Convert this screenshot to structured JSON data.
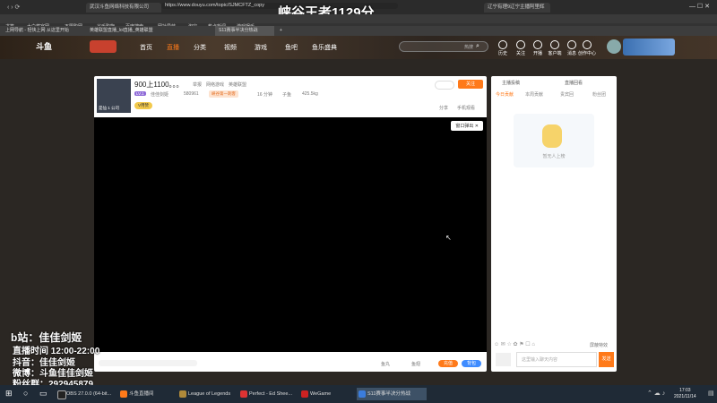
{
  "window": {
    "tab_title": "武汉斗鱼网络科技有限公司",
    "url": "https://www.douyu.com/topic/SJMCFTZ_copy",
    "overlay_title": "峡谷王者1129分",
    "right_tab": "辽宁有理9辽宁主播阿里辉",
    "new_tab": "+"
  },
  "bookmarks": [
    "书签",
    "大白菜官网",
    "不限购网",
    "谷乐购物",
    "百度搜索",
    "网址导航",
    "淘宝",
    "热点新闻",
    "游戏娱乐"
  ],
  "tabs": [
    "上网导航 - 轻快上网 从这里开始",
    "英雄联盟直播_lol直播_英雄联盟",
    "S11赛事半决分热战"
  ],
  "site": {
    "logo_text": "斗鱼",
    "nav": [
      "首页",
      "直播",
      "分类",
      "视频",
      "游戏",
      "鱼吧",
      "鱼乐盛典"
    ],
    "search_placeholder": "热搜",
    "header_icons": [
      "历史",
      "关注",
      "开播",
      "客户端",
      "消息",
      "创作中心"
    ]
  },
  "room": {
    "title": "900上1100。。。",
    "report": "举报",
    "tags": [
      "网络游戏",
      "英雄联盟"
    ],
    "streamer_name": "佳佳剑姬",
    "level": "LV.1",
    "fans": "580961",
    "badge": "峡谷第一刺客",
    "rank": "16 分钟",
    "gift": "子鱼",
    "hot": "425.5kg",
    "follow_btn": "关注",
    "share": "分享",
    "mobile": "手机观看",
    "popout": "窗口弹出",
    "vip": "V用赞",
    "avatar_caption": "是仙 1 公司",
    "bottom_labels": [
      "鱼丸",
      "鱼翅"
    ],
    "bottom_btn1": "充值",
    "bottom_btn2": "背包"
  },
  "chat": {
    "top_left": "主播投稿",
    "top_right": "直播回看",
    "tabs": [
      "今日贡献",
      "本周贡献",
      "贵宾回",
      "粉丝团"
    ],
    "empty_text": "暂无人上榜",
    "input_placeholder": "这里输入聊天内容",
    "send": "发送",
    "footer_btn": "屏蔽特效"
  },
  "overlay": {
    "bili": "b站：佳佳剑姬",
    "live_time": "直播时间 12:00-22:00",
    "douyin": "抖音：佳佳剑姬",
    "weibo": "微博：斗鱼佳佳剑姬",
    "fans_group": "粉丝群：292945879"
  },
  "taskbar": {
    "items": [
      "OBS 27.0.0 (64-bit...",
      "斗鱼直播间",
      "League of Legends",
      "Perfect - Ed Shee...",
      "WeGame",
      "S11赛事半决分热战"
    ],
    "time": "17:03",
    "date": "2021/11/14"
  },
  "colors": {
    "accent": "#ff7a1a",
    "taskbar": "#1f2a36"
  }
}
